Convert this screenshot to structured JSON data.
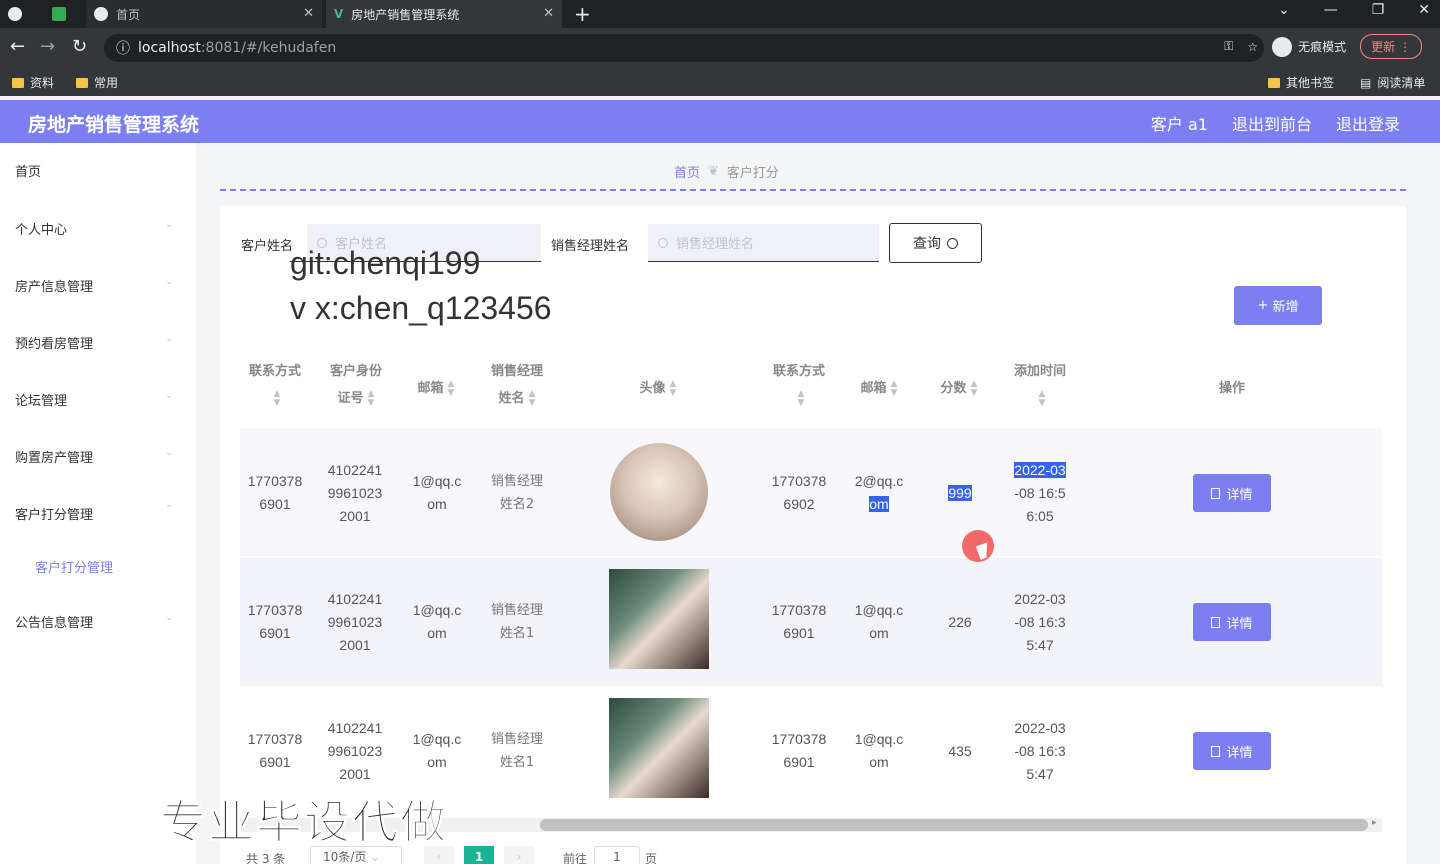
{
  "browser": {
    "tabs": [
      {
        "title": "首页"
      },
      {
        "title": "房地产销售管理系统"
      }
    ],
    "url_host": "localhost",
    "url_rest": ":8081/#/kehudafen",
    "incognito_label": "无痕模式",
    "update_label": "更新",
    "bookmarks": [
      "资料",
      "常用"
    ],
    "bookmarks_right": [
      "其他书签",
      "阅读清单"
    ]
  },
  "header": {
    "title": "房地产销售管理系统",
    "user": "客户 a1",
    "to_front": "退出到前台",
    "logout": "退出登录"
  },
  "sidebar": {
    "items": [
      {
        "label": "首页"
      },
      {
        "label": "个人中心"
      },
      {
        "label": "房产信息管理"
      },
      {
        "label": "预约看房管理"
      },
      {
        "label": "论坛管理"
      },
      {
        "label": "购置房产管理"
      },
      {
        "label": "客户打分管理"
      },
      {
        "label": "公告信息管理"
      }
    ],
    "sub_item": "客户打分管理"
  },
  "breadcrumb": {
    "home": "首页",
    "current": "客户打分"
  },
  "search": {
    "customer_label": "客户姓名",
    "customer_placeholder": "客户姓名",
    "manager_label": "销售经理姓名",
    "manager_placeholder": "销售经理姓名",
    "query_label": "查询",
    "add_label": "新增"
  },
  "overlay": {
    "git": "git:chenqi199",
    "wx": "v x:chen_q123456",
    "big": "专业毕设代做"
  },
  "table": {
    "headers": {
      "phone": [
        "联系方式"
      ],
      "idcard": [
        "客户身份",
        "证号"
      ],
      "email": [
        "邮箱"
      ],
      "manager": [
        "销售经理",
        "姓名"
      ],
      "avatar": [
        "头像"
      ],
      "phone2": [
        "联系方式"
      ],
      "email2": [
        "邮箱"
      ],
      "score": [
        "分数"
      ],
      "time": [
        "添加时间"
      ],
      "ops": [
        "操作"
      ]
    },
    "detail_label": "详情",
    "rows": [
      {
        "phone": [
          "1770378",
          "6901"
        ],
        "idcard": [
          "4102241",
          "9961023",
          "2001"
        ],
        "email": [
          "1@qq.c",
          "om"
        ],
        "manager": [
          "销售经理",
          "姓名2"
        ],
        "phone2": [
          "1770378",
          "6902"
        ],
        "email2": [
          "2@qq.c",
          "om"
        ],
        "score": "999",
        "time": [
          "2022-03",
          "-08 16:5",
          "6:05"
        ]
      },
      {
        "phone": [
          "1770378",
          "6901"
        ],
        "idcard": [
          "4102241",
          "9961023",
          "2001"
        ],
        "email": [
          "1@qq.c",
          "om"
        ],
        "manager": [
          "销售经理",
          "姓名1"
        ],
        "phone2": [
          "1770378",
          "6901"
        ],
        "email2": [
          "1@qq.c",
          "om"
        ],
        "score": "226",
        "time": [
          "2022-03",
          "-08 16:3",
          "5:47"
        ]
      },
      {
        "phone": [
          "1770378",
          "6901"
        ],
        "idcard": [
          "4102241",
          "9961023",
          "2001"
        ],
        "email": [
          "1@qq.c",
          "om"
        ],
        "manager": [
          "销售经理",
          "姓名1"
        ],
        "phone2": [
          "1770378",
          "6901"
        ],
        "email2": [
          "1@qq.c",
          "om"
        ],
        "score": "435",
        "time": [
          "2022-03",
          "-08 16:3",
          "5:47"
        ]
      }
    ]
  },
  "pager": {
    "total": "共 3 条",
    "size": "10条/页",
    "current": "1",
    "goto": "前往",
    "input": "1",
    "page": "页"
  },
  "colors": {
    "accent": "#7b7ff2",
    "pager_active": "#1bb394",
    "selection": "#3465e9"
  }
}
